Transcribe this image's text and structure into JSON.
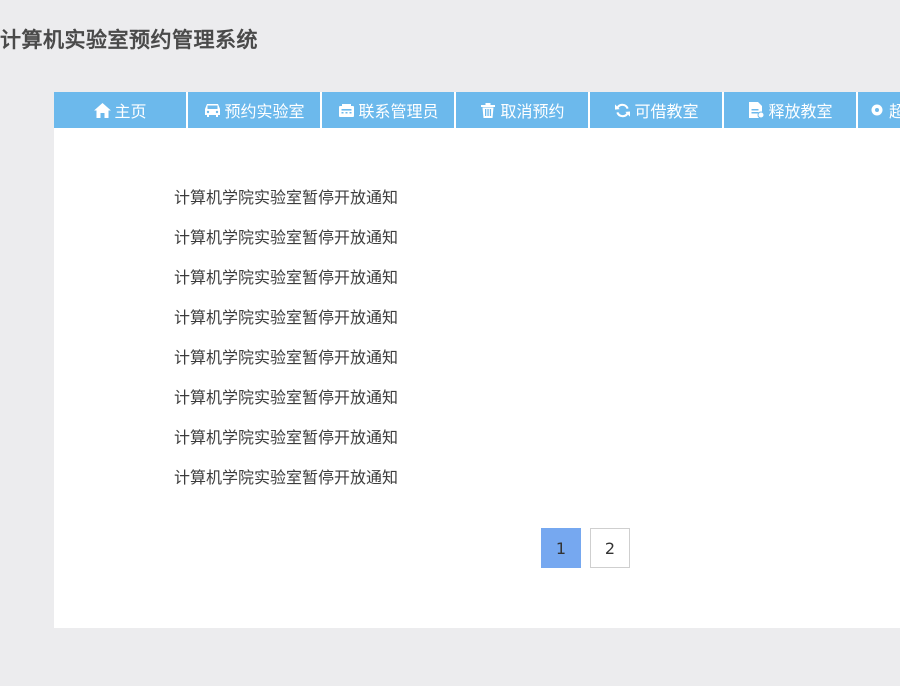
{
  "header": {
    "title": "计算机实验室预约管理系统"
  },
  "nav": {
    "items": [
      {
        "label": "主页",
        "icon": "home-icon"
      },
      {
        "label": "预约实验室",
        "icon": "car-icon"
      },
      {
        "label": "联系管理员",
        "icon": "fax-icon"
      },
      {
        "label": "取消预约",
        "icon": "trash-icon"
      },
      {
        "label": "可借教室",
        "icon": "refresh-icon"
      },
      {
        "label": "释放教室",
        "icon": "document-icon"
      },
      {
        "label": "超",
        "icon": "circle-icon"
      }
    ],
    "color": "#6cb9ec"
  },
  "notices": [
    "计算机学院实验室暂停开放通知",
    "计算机学院实验室暂停开放通知",
    "计算机学院实验室暂停开放通知",
    "计算机学院实验室暂停开放通知",
    "计算机学院实验室暂停开放通知",
    "计算机学院实验室暂停开放通知",
    "计算机学院实验室暂停开放通知",
    "计算机学院实验室暂停开放通知"
  ],
  "pagination": {
    "pages": [
      "1",
      "2"
    ],
    "current": "1"
  }
}
